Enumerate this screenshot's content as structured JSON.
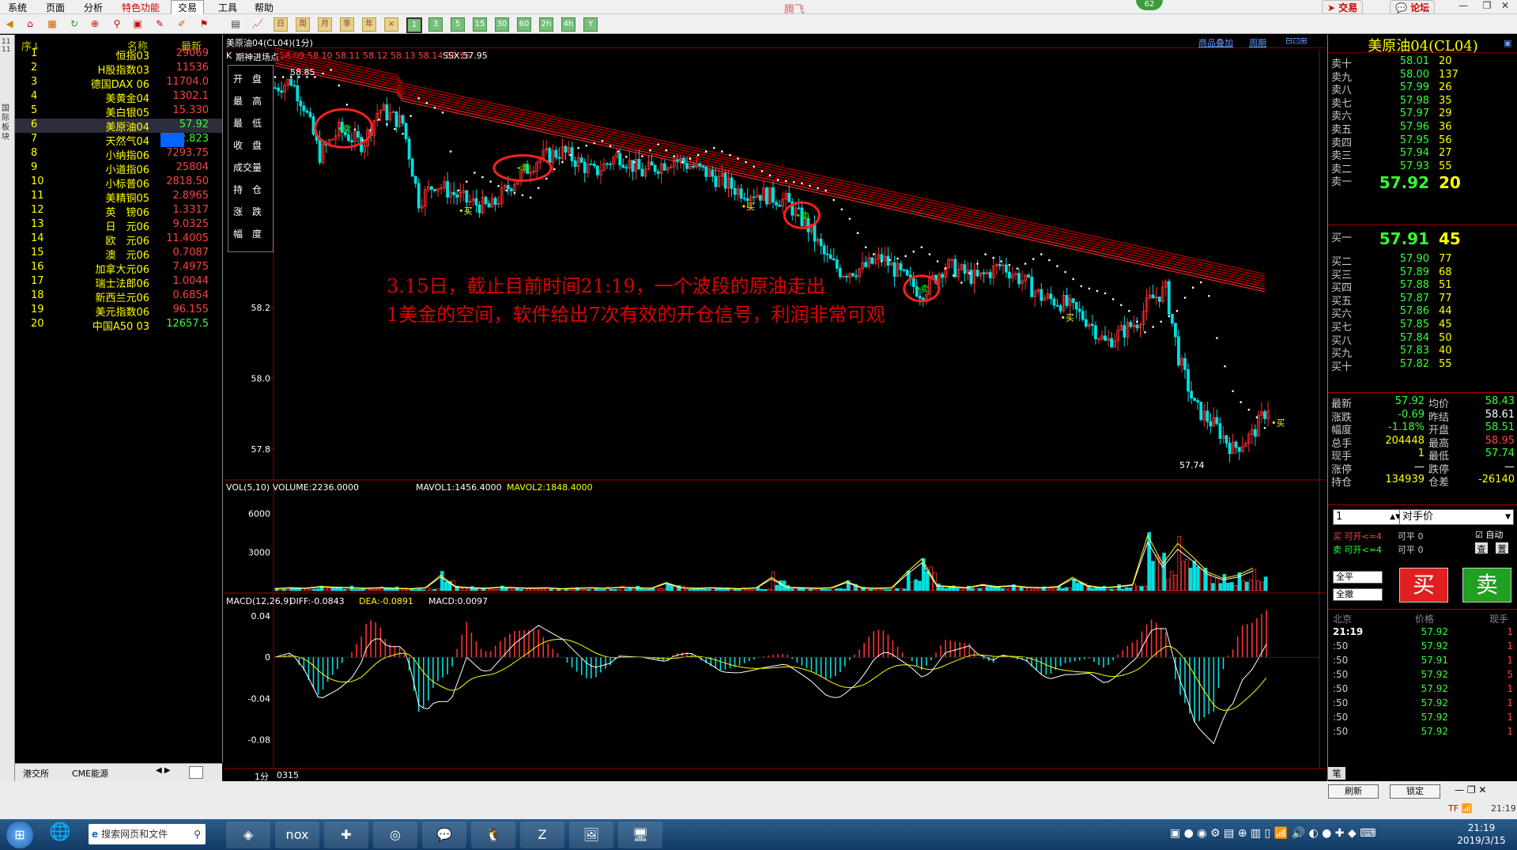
{
  "menu": {
    "items": [
      "系统",
      "页面",
      "分析",
      "特色功能",
      "交易",
      "工具",
      "帮助"
    ],
    "app_title": "腾飞",
    "badge": "62",
    "trade_btn": "交易",
    "forum_btn": "论坛"
  },
  "left_panel": {
    "strip_top": "11\n11",
    "strip_label": "国际板块",
    "headers": {
      "no": "序↓",
      "name": "名称",
      "price": "最新"
    },
    "rows": [
      {
        "no": "1",
        "name": "恒指03",
        "price": "29069",
        "color": "#ff4040"
      },
      {
        "no": "2",
        "name": "H股指数03",
        "price": "11536",
        "color": "#ff4040"
      },
      {
        "no": "3",
        "name": "德国DAX 06",
        "price": "11704.0",
        "color": "#ff4040"
      },
      {
        "no": "4",
        "name": "美黄金04",
        "price": "1302.1",
        "color": "#ff4040"
      },
      {
        "no": "5",
        "name": "美白银05",
        "price": "15.330",
        "color": "#ff4040"
      },
      {
        "no": "6",
        "name": "美原油04",
        "price": "57.92",
        "color": "#33ff33"
      },
      {
        "no": "7",
        "name": "天然气04",
        "price": "2.823",
        "color": "#33ff33"
      },
      {
        "no": "8",
        "name": "小纳指06",
        "price": "7293.75",
        "color": "#ff4040"
      },
      {
        "no": "9",
        "name": "小道指06",
        "price": "25804",
        "color": "#ff4040"
      },
      {
        "no": "10",
        "name": "小标普06",
        "price": "2818.50",
        "color": "#ff4040"
      },
      {
        "no": "11",
        "name": "美精铜05",
        "price": "2.8965",
        "color": "#ff4040"
      },
      {
        "no": "12",
        "name": "英　镑06",
        "price": "1.3317",
        "color": "#ff4040"
      },
      {
        "no": "13",
        "name": "日　元06",
        "price": "9.0325",
        "color": "#ff4040"
      },
      {
        "no": "14",
        "name": "欧　元06",
        "price": "11.4005",
        "color": "#ff4040"
      },
      {
        "no": "15",
        "name": "澳　元06",
        "price": "0.7087",
        "color": "#ff4040"
      },
      {
        "no": "16",
        "name": "加拿大元06",
        "price": "7.4975",
        "color": "#ff4040"
      },
      {
        "no": "17",
        "name": "瑞士法郎06",
        "price": "1.0044",
        "color": "#ff4040"
      },
      {
        "no": "18",
        "name": "新西兰元06",
        "price": "0.6854",
        "color": "#ff4040"
      },
      {
        "no": "19",
        "name": "美元指数06",
        "price": "96.155",
        "color": "#ff4040"
      },
      {
        "no": "20",
        "name": "中国A50 03",
        "price": "12657.5",
        "color": "#33ff33"
      }
    ],
    "tabs": [
      "港交所",
      "CME能源"
    ]
  },
  "chart": {
    "header_title": "美原油04(CL04)(1分)",
    "link1": "商品叠加",
    "link2": "周期",
    "k_label": "K",
    "signal_label": "期神进场点",
    "signal_values": "58.09 58.10 58.11 58.12 58.13 58.14 58.15",
    "ssx": "SSX:57.95",
    "info_labels": [
      "开　盘",
      "最　高",
      "最　低",
      "收　盘",
      "成交量",
      "持　仓",
      "涨　跌",
      "幅　度"
    ],
    "max_label": "58.85",
    "min_label": "57.74",
    "buy": "买",
    "sell": "卖",
    "annotation": "3.15日，截止目前时间21:19，一个波段的原油走出\n1美金的空间，软件给出7次有效的开仓信号，利润非常可观",
    "vol_header": {
      "a": "VOL(5,10) VOLUME:2236.0000",
      "b": "MAVOL1:1456.4000",
      "c": "MAVOL2:1848.4000"
    },
    "macd_header": {
      "a": "MACD(12,26,9)",
      "b": "DIFF:-0.0843",
      "c": "DEA:-0.0891",
      "d": "MACD:0.0097"
    },
    "period": "1分",
    "date": "0315"
  },
  "chart_data": {
    "type": "candlestick",
    "price_axis_ticks": [
      "58.2",
      "58.0",
      "57.8"
    ],
    "price_tick_values": [
      58.2,
      58.0,
      57.8
    ],
    "price_range": [
      57.72,
      58.88
    ],
    "volume_axis_ticks": [
      "6000",
      "3000"
    ],
    "volume_tick_values": [
      6000,
      3000
    ],
    "volume_range": [
      0,
      7200
    ],
    "macd_axis_ticks": [
      "0.04",
      "0",
      "-0.04",
      "-0.08"
    ],
    "macd_tick_values": [
      0.04,
      0,
      -0.04,
      -0.08
    ],
    "macd_range": [
      -0.105,
      0.05
    ],
    "high": 58.85,
    "low": 57.74,
    "last": 57.92,
    "price_path": [
      [
        0,
        58.82
      ],
      [
        10,
        58.84
      ],
      [
        18,
        58.77
      ],
      [
        28,
        58.63
      ],
      [
        40,
        58.7
      ],
      [
        55,
        58.66
      ],
      [
        65,
        58.76
      ],
      [
        80,
        58.72
      ],
      [
        90,
        58.5
      ],
      [
        100,
        58.55
      ],
      [
        120,
        58.5
      ],
      [
        135,
        58.48
      ],
      [
        150,
        58.56
      ],
      [
        165,
        58.62
      ],
      [
        180,
        58.64
      ],
      [
        200,
        58.58
      ],
      [
        215,
        58.63
      ],
      [
        230,
        58.58
      ],
      [
        250,
        58.62
      ],
      [
        270,
        58.58
      ],
      [
        290,
        58.53
      ],
      [
        305,
        58.52
      ],
      [
        320,
        58.5
      ],
      [
        335,
        58.42
      ],
      [
        345,
        58.34
      ],
      [
        355,
        58.3
      ],
      [
        368,
        58.31
      ],
      [
        380,
        58.34
      ],
      [
        395,
        58.28
      ],
      [
        405,
        58.24
      ],
      [
        420,
        58.32
      ],
      [
        440,
        58.28
      ],
      [
        455,
        58.32
      ],
      [
        470,
        58.27
      ],
      [
        480,
        58.23
      ],
      [
        495,
        58.21
      ],
      [
        510,
        58.16
      ],
      [
        520,
        58.1
      ],
      [
        530,
        58.13
      ],
      [
        540,
        58.16
      ],
      [
        548,
        58.22
      ],
      [
        558,
        58.25
      ],
      [
        566,
        58.06
      ],
      [
        576,
        57.92
      ],
      [
        590,
        57.86
      ],
      [
        600,
        57.8
      ],
      [
        612,
        57.84
      ],
      [
        622,
        57.92
      ]
    ],
    "buy_signal_x": [
      113,
      290,
      490,
      658,
      740,
      1018
    ],
    "sell_signal_x": [
      43,
      155,
      330,
      405,
      698,
      812,
      940
    ],
    "volume": [
      200,
      300,
      250,
      400,
      350,
      300,
      250,
      300,
      250,
      200,
      300,
      1500,
      400,
      300,
      250,
      350,
      300,
      250,
      300,
      200,
      250,
      300,
      250,
      350,
      300,
      250,
      800,
      300,
      250,
      300,
      250,
      200,
      300,
      1300,
      350,
      300,
      250,
      300,
      900,
      300,
      250,
      300,
      1800,
      3100,
      500,
      400,
      300,
      600,
      400,
      500,
      350,
      300,
      400,
      1300,
      500,
      300,
      400,
      600,
      5400,
      2600,
      4600,
      3300,
      1800,
      1200,
      1500,
      2200
    ]
  },
  "right_panel": {
    "title": "美原油04(CL04)",
    "asks": [
      {
        "l": "卖十",
        "p": "58.01",
        "v": "20"
      },
      {
        "l": "卖九",
        "p": "58.00",
        "v": "137"
      },
      {
        "l": "卖八",
        "p": "57.99",
        "v": "26"
      },
      {
        "l": "卖七",
        "p": "57.98",
        "v": "35"
      },
      {
        "l": "卖六",
        "p": "57.97",
        "v": "29"
      },
      {
        "l": "卖五",
        "p": "57.96",
        "v": "36"
      },
      {
        "l": "卖四",
        "p": "57.95",
        "v": "56"
      },
      {
        "l": "卖三",
        "p": "57.94",
        "v": "27"
      },
      {
        "l": "卖二",
        "p": "57.93",
        "v": "55"
      },
      {
        "l": "卖一",
        "p": "57.92",
        "v": "20"
      }
    ],
    "bids": [
      {
        "l": "买一",
        "p": "57.91",
        "v": "45"
      },
      {
        "l": "买二",
        "p": "57.90",
        "v": "77"
      },
      {
        "l": "买三",
        "p": "57.89",
        "v": "68"
      },
      {
        "l": "买四",
        "p": "57.88",
        "v": "51"
      },
      {
        "l": "买五",
        "p": "57.87",
        "v": "77"
      },
      {
        "l": "买六",
        "p": "57.86",
        "v": "44"
      },
      {
        "l": "买七",
        "p": "57.85",
        "v": "45"
      },
      {
        "l": "买八",
        "p": "57.84",
        "v": "50"
      },
      {
        "l": "买九",
        "p": "57.83",
        "v": "40"
      },
      {
        "l": "买十",
        "p": "57.82",
        "v": "55"
      }
    ],
    "stats": [
      {
        "l1": "最新",
        "v1": "57.92",
        "c1": "#33ff33",
        "l2": "均价",
        "v2": "58.43",
        "c2": "#33ff33"
      },
      {
        "l1": "涨跌",
        "v1": "-0.69",
        "c1": "#33ff33",
        "l2": "昨结",
        "v2": "58.61",
        "c2": "#ffffff"
      },
      {
        "l1": "幅度",
        "v1": "-1.18%",
        "c1": "#33ff33",
        "l2": "开盘",
        "v2": "58.51",
        "c2": "#33ff33"
      },
      {
        "l1": "总手",
        "v1": "204448",
        "c1": "#ffff00",
        "l2": "最高",
        "v2": "58.95",
        "c2": "#ff4040"
      },
      {
        "l1": "现手",
        "v1": "1",
        "c1": "#ffff00",
        "l2": "最低",
        "v2": "57.74",
        "c2": "#33ff33"
      },
      {
        "l1": "涨停",
        "v1": "—",
        "c1": "#ffffff",
        "l2": "跌停",
        "v2": "—",
        "c2": "#ffffff"
      },
      {
        "l1": "持仓",
        "v1": "134939",
        "c1": "#ffff00",
        "l2": "仓差",
        "v2": "-26140",
        "c2": "#ffff00"
      }
    ],
    "order": {
      "qty": "1",
      "price_type": "对手价",
      "buy_open": "买 可开<=4",
      "sell_open": "卖 可开<=4",
      "can_close1": "可平 0",
      "can_close2": "可平 0",
      "auto": "自动",
      "check": "查",
      "clear": "置",
      "close_all": "全平",
      "cancel_all": "全撤",
      "buy_btn": "买",
      "sell_btn": "卖"
    },
    "ticks_header": {
      "t": "北京",
      "p": "价格",
      "v": "现手"
    },
    "ticks": [
      {
        "t": "21:19",
        "p": "57.92",
        "v": "1"
      },
      {
        "t": ":50",
        "p": "57.92",
        "v": "1"
      },
      {
        "t": ":50",
        "p": "57.91",
        "v": "1"
      },
      {
        "t": ":50",
        "p": "57.92",
        "v": "5"
      },
      {
        "t": ":50",
        "p": "57.92",
        "v": "1"
      },
      {
        "t": ":50",
        "p": "57.92",
        "v": "1"
      },
      {
        "t": ":50",
        "p": "57.92",
        "v": "1"
      },
      {
        "t": ":50",
        "p": "57.92",
        "v": "1"
      }
    ],
    "bottom_label": "笔"
  },
  "bottom": {
    "refresh": "刷新",
    "lock": "锁定",
    "tray_time": "21:19"
  },
  "taskbar": {
    "search_placeholder": "搜索网页和文件",
    "time": "21:19",
    "date": "2019/3/15"
  }
}
